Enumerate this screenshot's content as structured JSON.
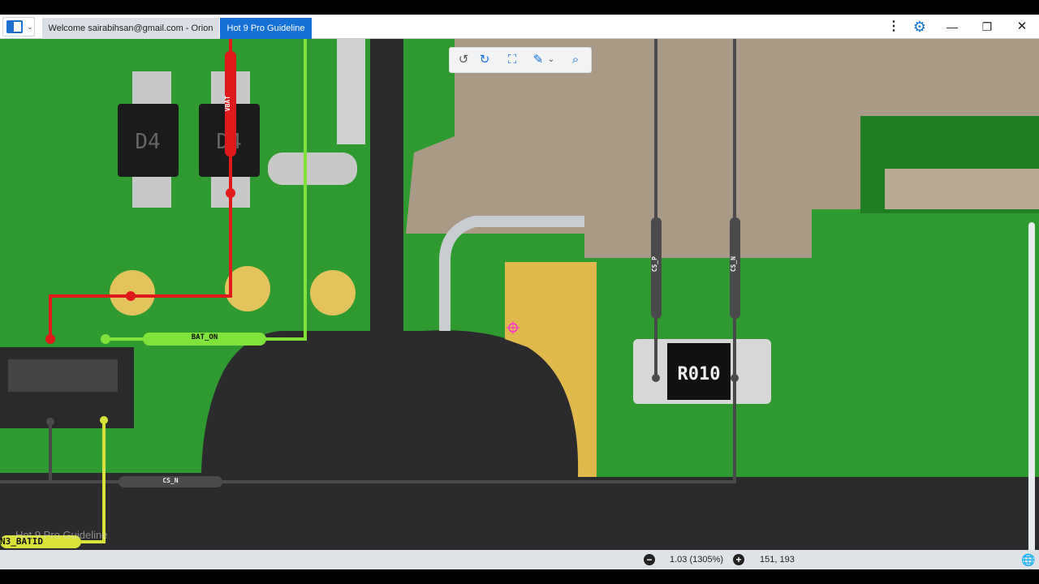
{
  "window": {
    "tabs": [
      {
        "label": "Welcome sairabihsan@gmail.com - Orion"
      },
      {
        "label": "Hot 9 Pro Guideline"
      }
    ],
    "controls": {
      "menu": "⋮",
      "settings": "⚙",
      "minimize": "—",
      "maximize": "❐",
      "close": "✕"
    }
  },
  "toolbar": {
    "icons": [
      "rotate-left-icon",
      "rotate-right-icon",
      "fit-screen-icon",
      "measure-icon",
      "search-icon"
    ]
  },
  "board": {
    "watermark": "Hot 9 Pro Guideline",
    "nets": {
      "vbat": "VBAT",
      "bat_on": "BAT_ON",
      "cs_n_bottom": "CS_N",
      "cs_p": "CS_P",
      "cs_n_right": "CS_N",
      "batid": "N3_BATID"
    },
    "component_marking": "R010",
    "diode_markings": [
      "D4",
      "D4"
    ]
  },
  "status": {
    "zoom": "1.03 (1305%)",
    "coords": "151, 193",
    "zoom_out": "−",
    "zoom_in": "+"
  },
  "colors": {
    "accent": "#1571d6",
    "pcb_green": "#2f9a2f",
    "net_red": "#e0191b",
    "net_green": "#7fe33c",
    "net_yellow": "#d8e23a",
    "net_gray": "#4a4a4d"
  }
}
